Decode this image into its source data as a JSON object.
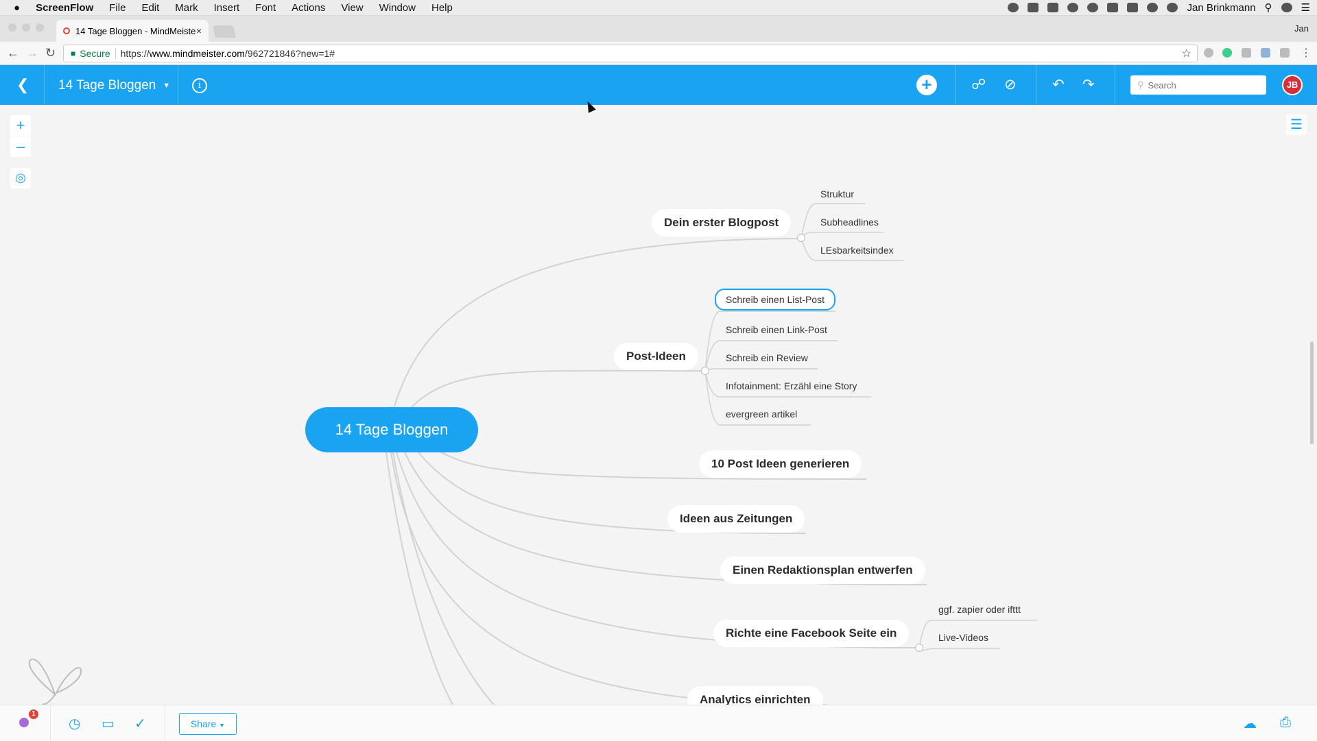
{
  "menubar": {
    "apple": "",
    "app_name": "ScreenFlow",
    "items": [
      "File",
      "Edit",
      "Mark",
      "Insert",
      "Font",
      "Actions",
      "View",
      "Window",
      "Help"
    ],
    "user": "Jan Brinkmann"
  },
  "browser": {
    "tab_title": "14 Tage Bloggen - MindMeiste",
    "tab_close": "×",
    "profile": "Jan",
    "secure_label": "Secure",
    "url_scheme": "https://",
    "url_domain": "www.mindmeister.com",
    "url_path": "/962721846?new=1#"
  },
  "mindmeister": {
    "map_title": "14 Tage Bloggen",
    "search_placeholder": "Search",
    "avatar_initials": "JB"
  },
  "map": {
    "root": "14 Tage Bloggen",
    "branches": [
      {
        "label": "Dein erster Blogpost",
        "children": [
          "Struktur",
          "Subheadlines",
          "LEsbarkeitsindex"
        ]
      },
      {
        "label": "Post-Ideen",
        "children": [
          "Schreib einen List-Post",
          "Schreib einen Link-Post",
          "Schreib ein Review",
          "Infotainment: Erzähl eine Story",
          "evergreen artikel"
        ]
      },
      {
        "label": "10 Post Ideen generieren"
      },
      {
        "label": "Ideen aus Zeitungen"
      },
      {
        "label": "Einen Redaktionsplan entwerfen"
      },
      {
        "label": "Richte eine Facebook Seite ein",
        "children": [
          "ggf. zapier oder ifttt",
          "Live-Videos"
        ]
      },
      {
        "label": "Analytics einrichten"
      }
    ],
    "selected_child": "Schreib einen List-Post"
  },
  "bottombar": {
    "share_label": "Share",
    "notification_count": "1"
  },
  "colors": {
    "accent": "#1aa3f0",
    "avatar": "#d52f3b",
    "canvas": "#f4f4f5"
  }
}
